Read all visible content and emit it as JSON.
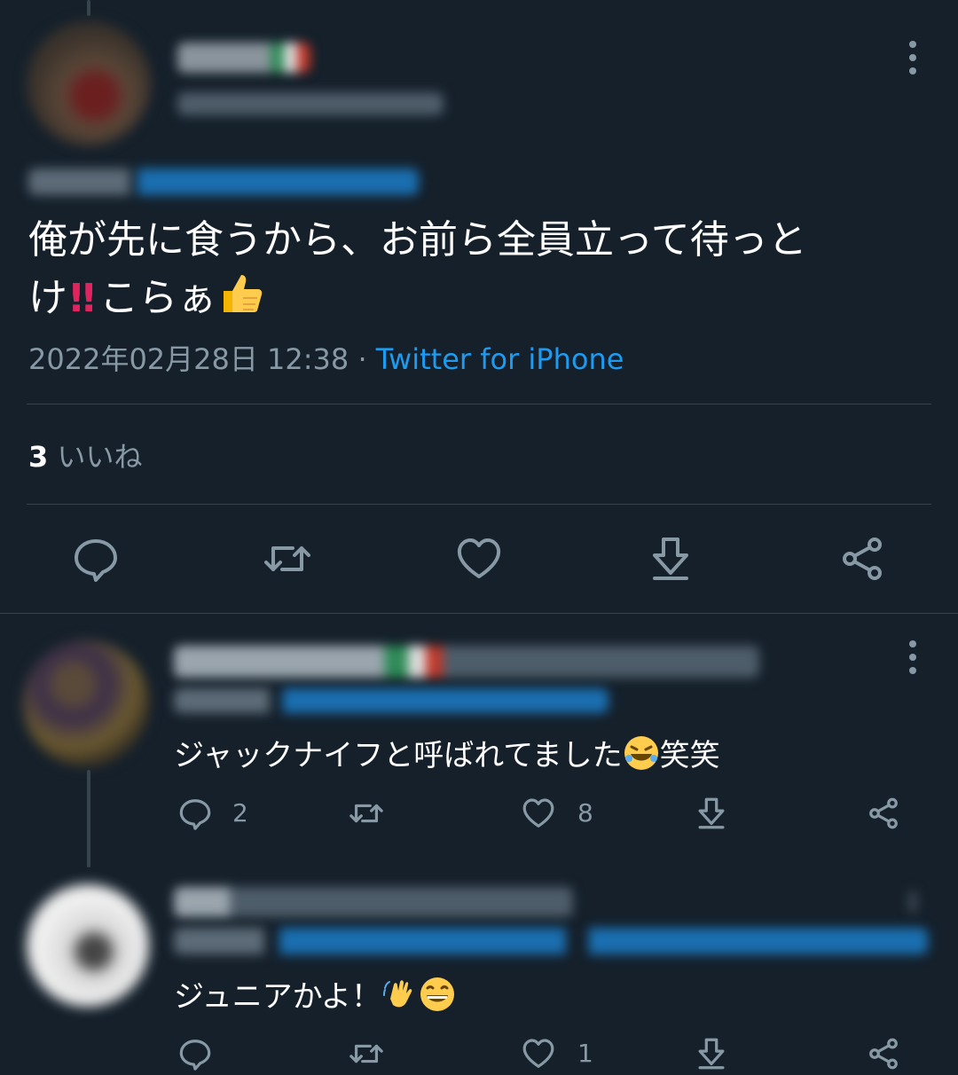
{
  "main_tweet": {
    "text_line1": "俺が先に食うから、お前ら全員立って待っと",
    "text_line2": "け",
    "text_line2b": "こらぁ",
    "timestamp": "2022年02月28日 12:38",
    "separator": " · ",
    "source": "Twitter for iPhone",
    "likes_count": "3",
    "likes_label": " いいね"
  },
  "replies": [
    {
      "text": "ジャックナイフと呼ばれてました",
      "text_suffix": "笑笑",
      "reply_count": "2",
      "like_count": "8"
    },
    {
      "text": "ジュニアかよ！",
      "like_count": "1"
    }
  ],
  "icons": [
    "reply-icon",
    "retweet-icon",
    "like-icon",
    "share-download-icon",
    "share-icon",
    "more-icon"
  ],
  "colors": {
    "background": "#15202b",
    "muted": "#8899a6",
    "link": "#1d9bf0",
    "divider": "#38444d"
  }
}
